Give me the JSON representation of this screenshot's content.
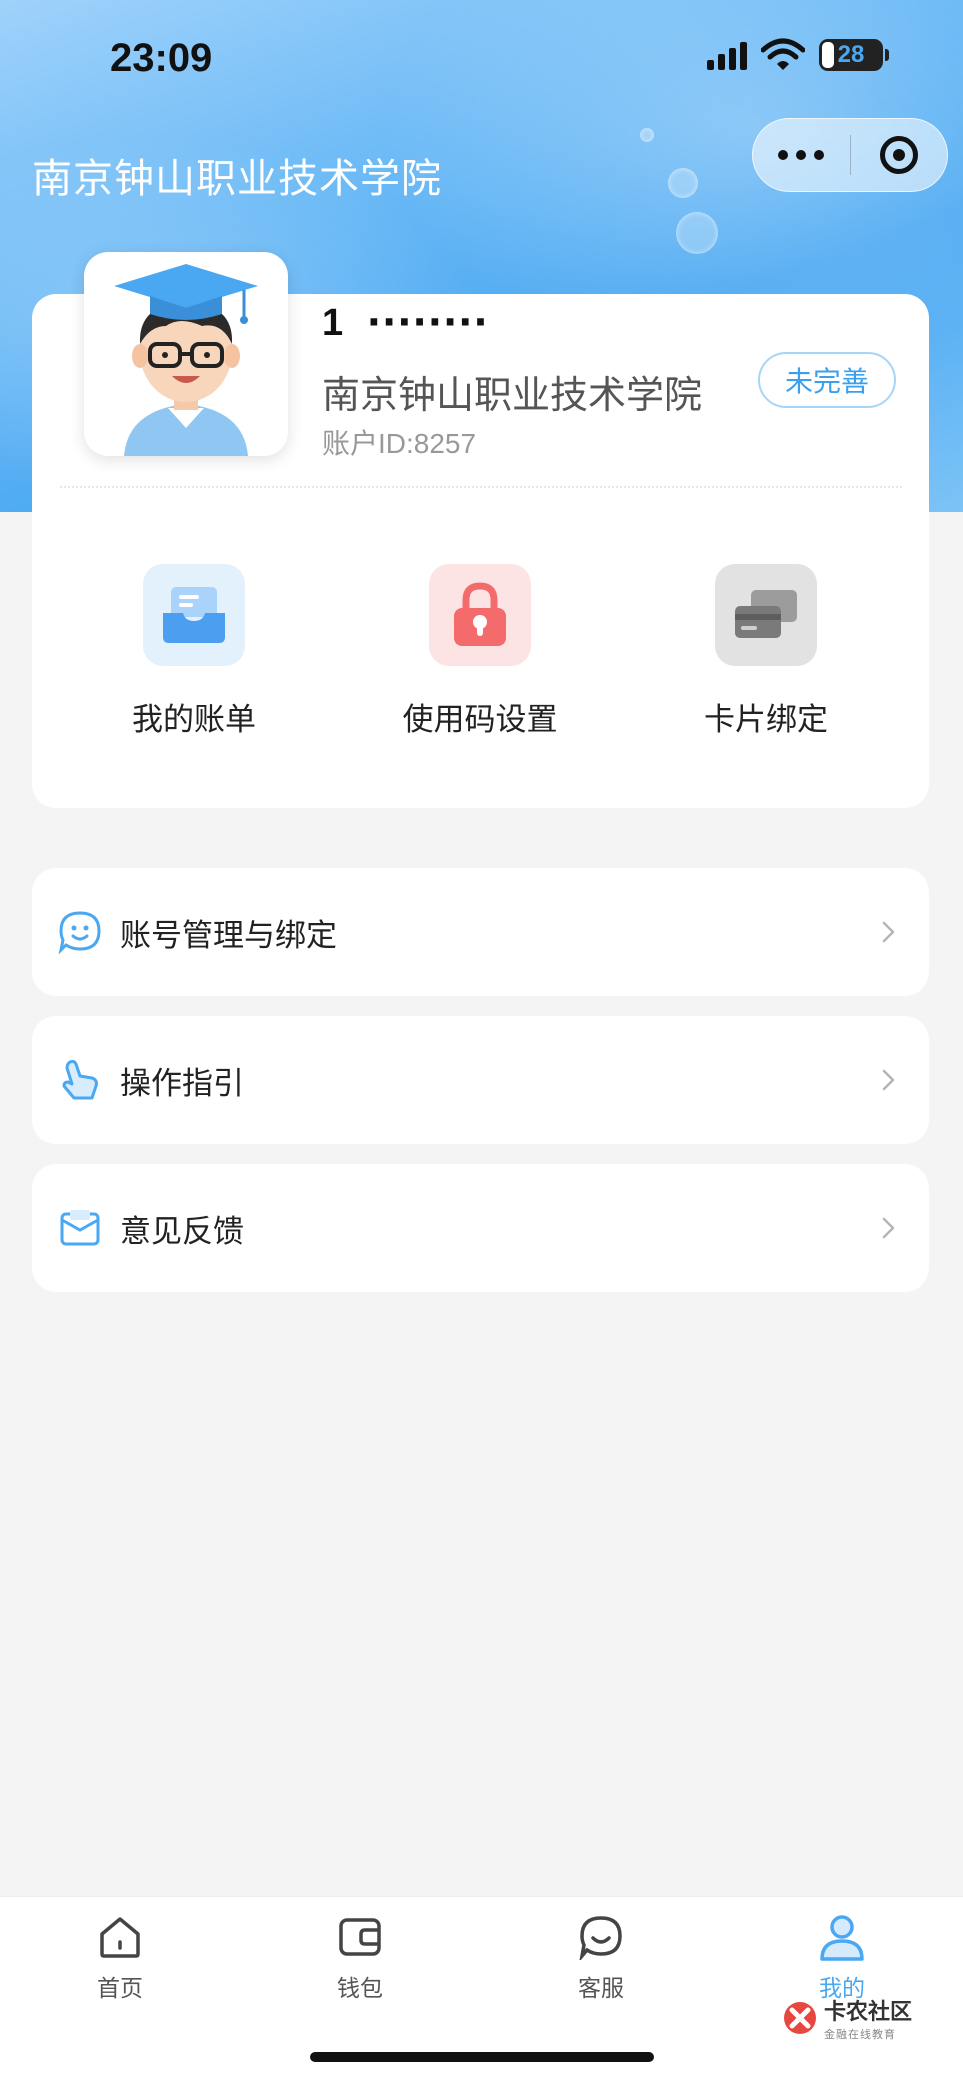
{
  "status_bar": {
    "time": "23:09",
    "battery": "28"
  },
  "mini_program": {
    "title": "南京钟山职业技术学院"
  },
  "profile": {
    "phone": "1  ‧‧‧‧‧‧‧‧",
    "school": "南京钟山职业技术学院",
    "account_id": "账户ID:8257",
    "status_button": "未完善"
  },
  "quick_actions": [
    {
      "label": "我的账单",
      "icon": "bill-tray-icon"
    },
    {
      "label": "使用码设置",
      "icon": "lock-icon"
    },
    {
      "label": "卡片绑定",
      "icon": "cards-icon"
    }
  ],
  "menu": [
    {
      "label": "账号管理与绑定",
      "icon": "smile-chat-icon"
    },
    {
      "label": "操作指引",
      "icon": "pointing-hand-icon"
    },
    {
      "label": "意见反馈",
      "icon": "envelope-icon"
    }
  ],
  "tabbar": {
    "items": [
      {
        "label": "首页",
        "icon": "home-icon"
      },
      {
        "label": "钱包",
        "icon": "wallet-icon"
      },
      {
        "label": "客服",
        "icon": "chat-smile-icon"
      },
      {
        "label": "我的",
        "icon": "user-icon",
        "active": true
      }
    ]
  },
  "watermark": {
    "name": "卡农社区",
    "slogan": "金融在线教育"
  },
  "colors": {
    "accent": "#4aa8f2",
    "background": "#f4f4f4"
  }
}
